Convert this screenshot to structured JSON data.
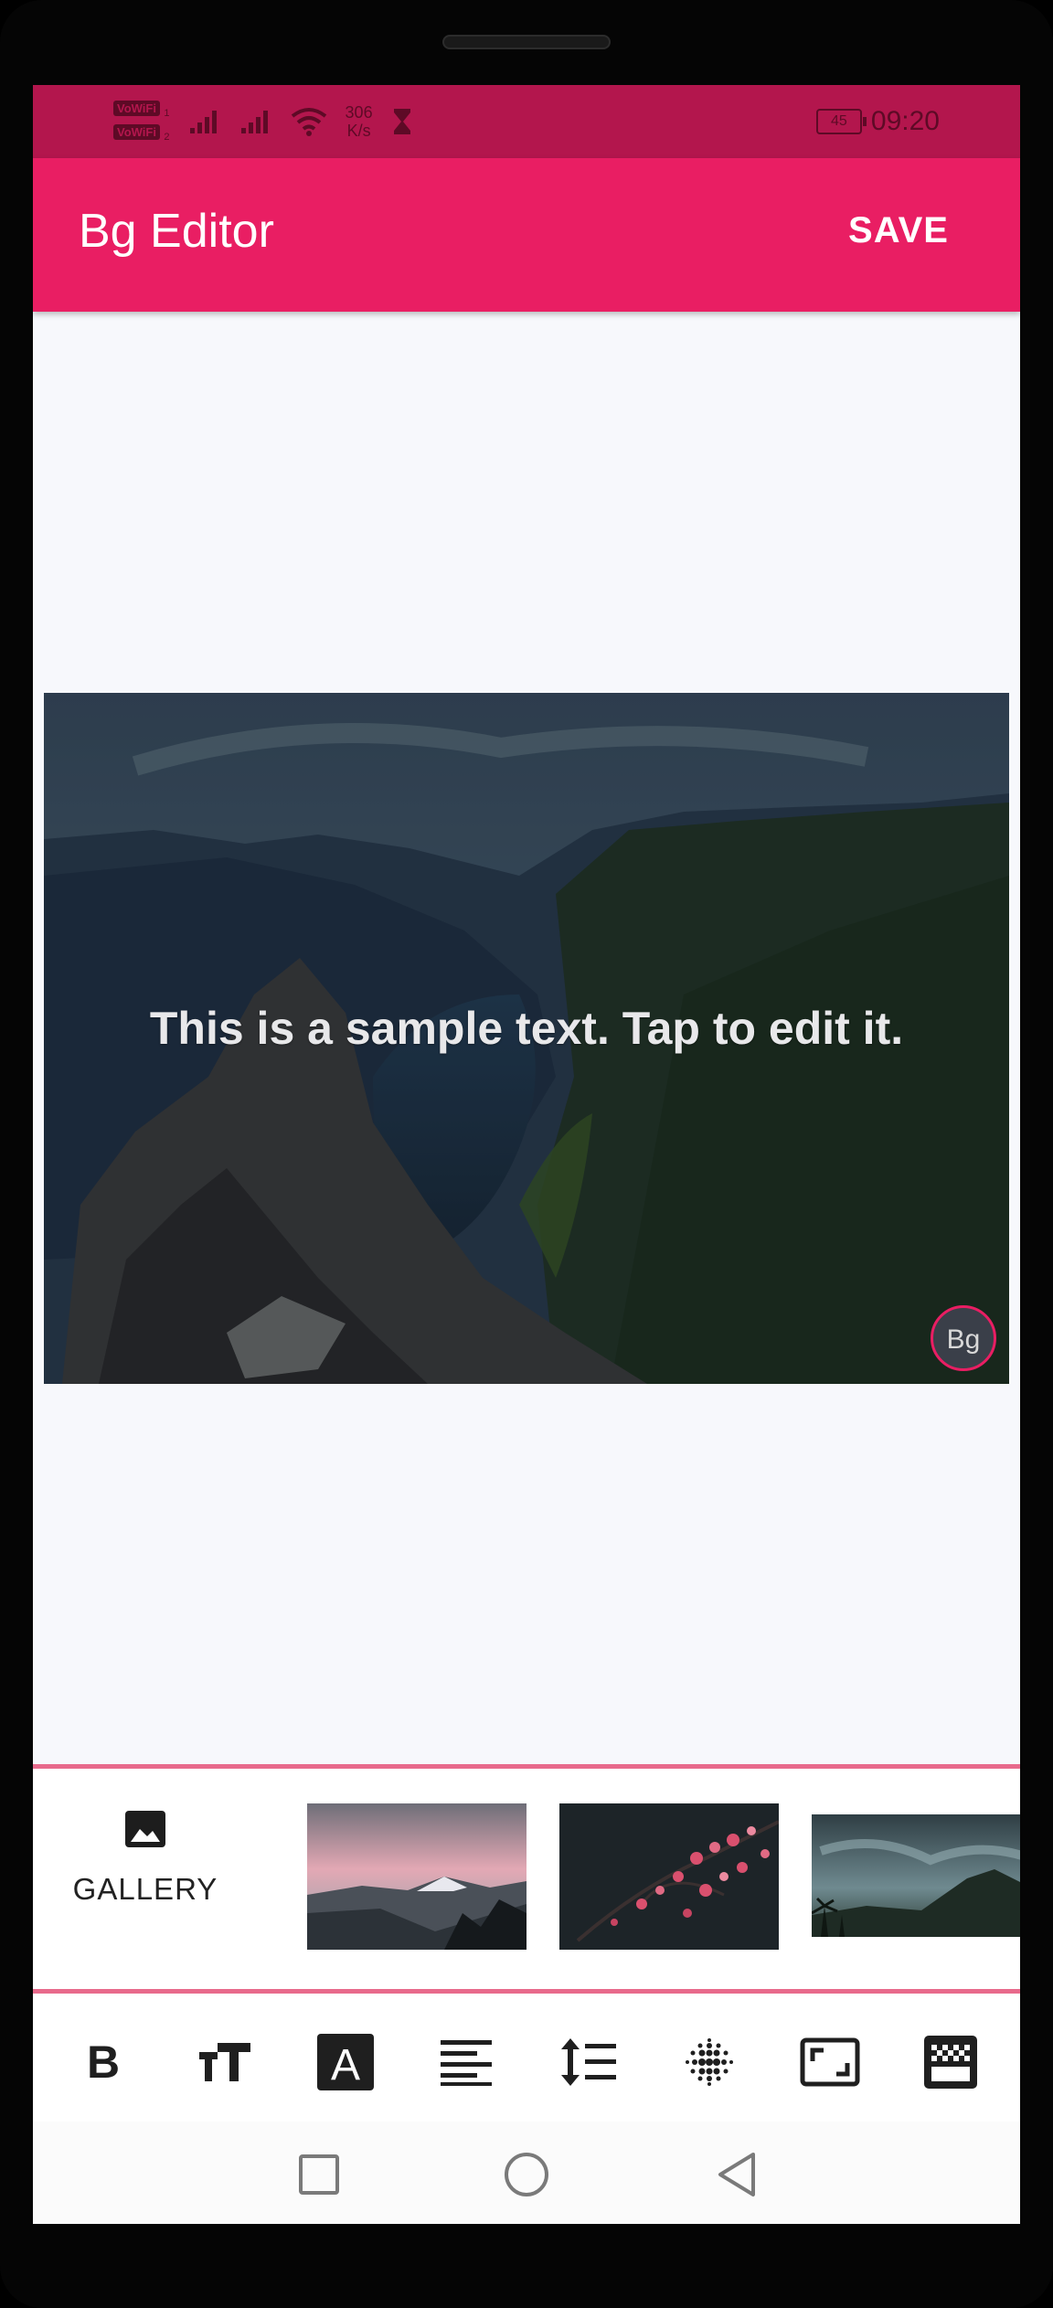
{
  "status_bar": {
    "vowifi_label": "VoWiFi",
    "sim1": "1",
    "sim2": "2",
    "speed_value": "306",
    "speed_unit": "K/s",
    "battery": "45",
    "time": "09:20"
  },
  "app_bar": {
    "title": "Bg Editor",
    "save_label": "SAVE"
  },
  "canvas": {
    "sample_text": "This is a sample text. Tap to edit it.",
    "bg_badge": "Bg"
  },
  "bg_picker": {
    "gallery_label": "GALLERY",
    "thumbnails": [
      "pink-sky-mountains",
      "pink-blossoms",
      "stormy-landscape"
    ]
  },
  "toolbar": {
    "tools": [
      "bold-icon",
      "text-size-icon",
      "text-color-icon",
      "align-left-icon",
      "line-spacing-icon",
      "blur-icon",
      "resize-icon",
      "opacity-icon"
    ]
  },
  "nav_bar": {
    "buttons": [
      "recents",
      "home",
      "back"
    ]
  },
  "colors": {
    "accent": "#e91e63",
    "status_bar": "#b3164d",
    "divider": "#e86a8c",
    "background": "#f7f8fc"
  }
}
